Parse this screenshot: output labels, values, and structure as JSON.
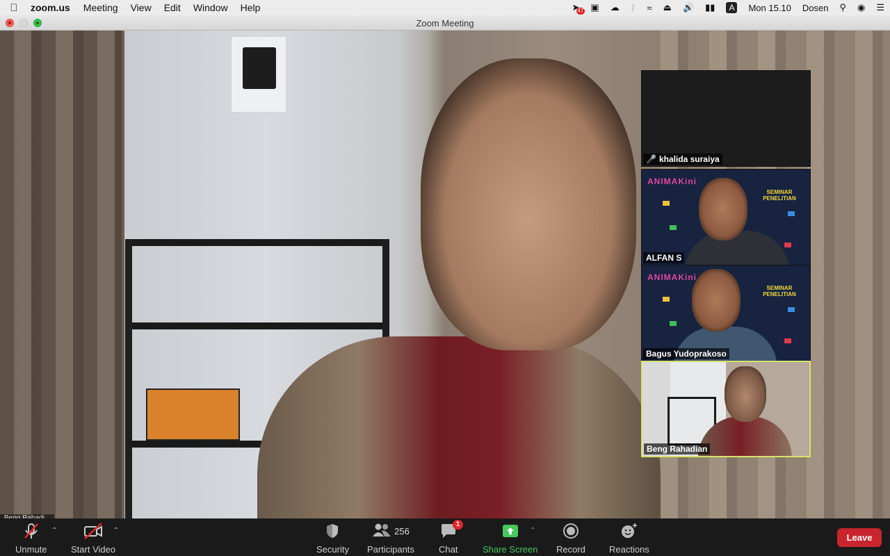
{
  "menubar": {
    "app_name": "zoom.us",
    "items": [
      "Meeting",
      "View",
      "Edit",
      "Window",
      "Help"
    ],
    "notification_count": "47",
    "input_source": "A",
    "clock": "Mon 15.10",
    "user": "Dosen"
  },
  "window": {
    "title": "Zoom Meeting"
  },
  "main_video": {
    "speaker_name_partial": "Beng Rahadi..."
  },
  "thumbnails": [
    {
      "name": "khalida suraiya",
      "muted": true
    },
    {
      "name": "ALFAN S",
      "background_logo": "ANIMAKini",
      "background_text": "SEMINAR PENELITIAN"
    },
    {
      "name": "Bagus Yudoprakoso",
      "background_logo": "ANIMAKini",
      "background_text": "SEMINAR PENELITIAN"
    },
    {
      "name": "Beng Rahadian",
      "active_speaker": true
    }
  ],
  "toolbar": {
    "unmute": "Unmute",
    "start_video": "Start Video",
    "security": "Security",
    "participants": "Participants",
    "participant_count": "256",
    "chat": "Chat",
    "chat_badge": "1",
    "share_screen": "Share Screen",
    "record": "Record",
    "reactions": "Reactions",
    "leave": "Leave"
  },
  "colors": {
    "share_green": "#46c75a",
    "leave_red": "#c8252c",
    "active_speaker_border": "#d8e36a"
  }
}
